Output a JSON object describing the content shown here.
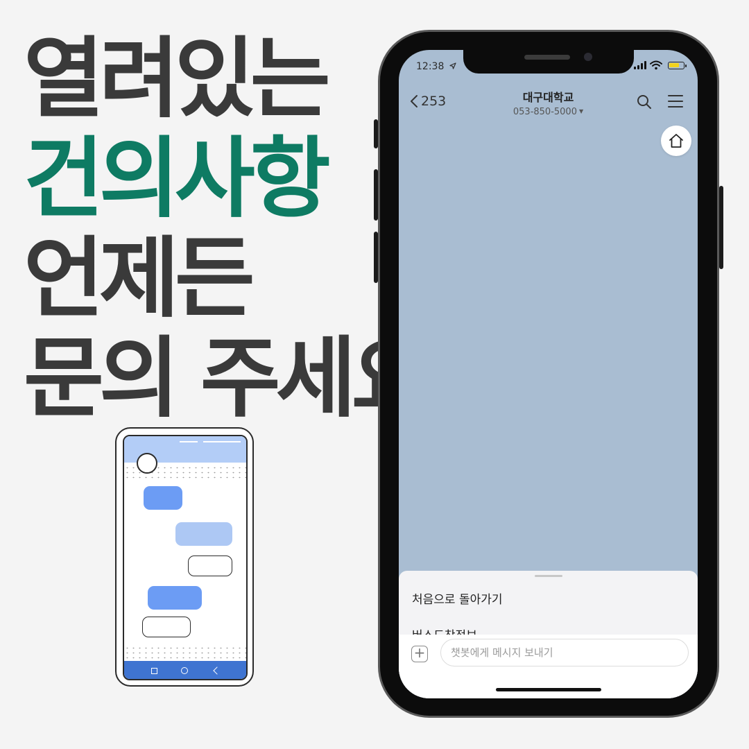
{
  "headline": {
    "line1": "열려있는",
    "line2": "건의사항",
    "line3": "언제든",
    "line4": "문의 주세요"
  },
  "status_bar": {
    "time": "12:38"
  },
  "chat_header": {
    "back_count": "253",
    "title": "대구대학교",
    "subtitle": "053-850-5000"
  },
  "quick_menu": {
    "items": [
      "처음으로 돌아가기",
      "버스도착정보"
    ]
  },
  "composer": {
    "placeholder": "챗봇에게 메시지 보내기"
  },
  "colors": {
    "accent_green": "#0e7b63",
    "chat_background": "#a9bdd2",
    "illustration_blue": "#6c9cf4",
    "battery_yellow": "#f1d21d"
  },
  "icons": [
    "location-arrow-icon",
    "signal-icon",
    "wifi-icon",
    "battery-icon",
    "back-chevron-icon",
    "dropdown-caret-icon",
    "search-icon",
    "hamburger-menu-icon",
    "home-icon",
    "plus-icon"
  ]
}
